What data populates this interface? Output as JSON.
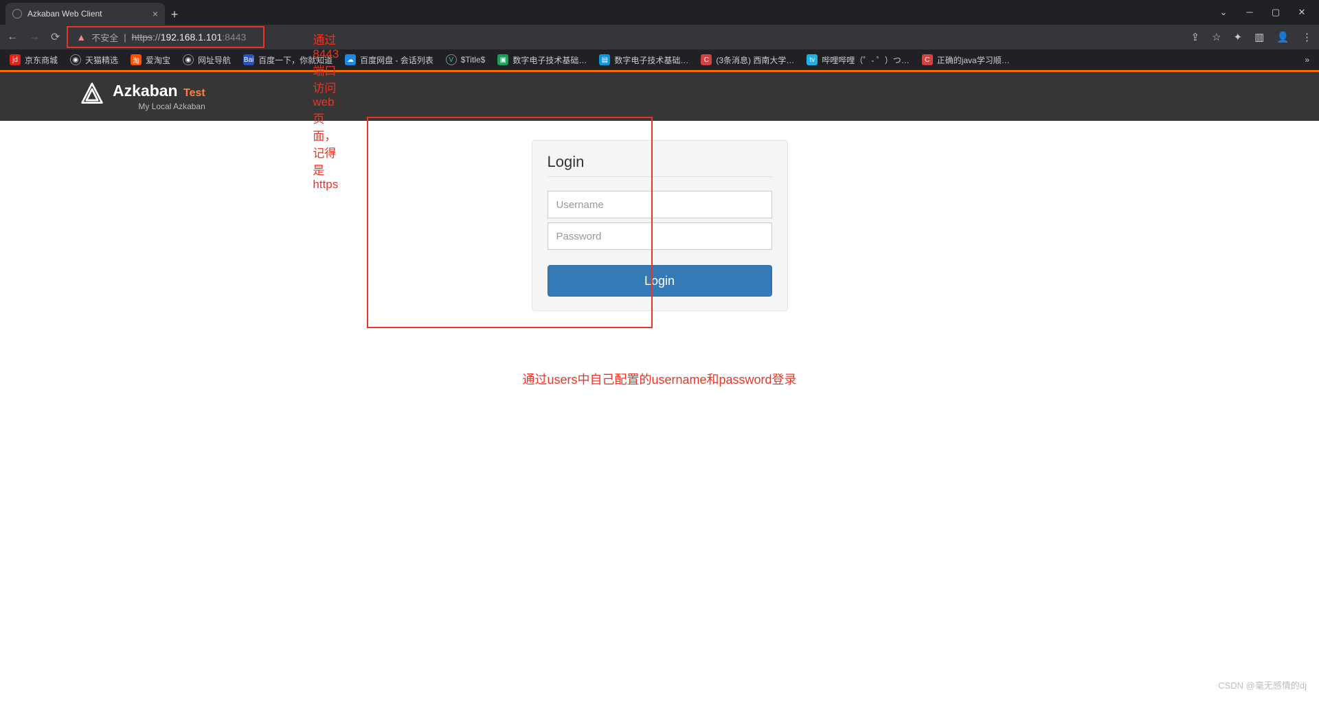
{
  "browser": {
    "tab_title": "Azkaban Web Client",
    "url_insecure_label": "不安全",
    "url_protocol": "https",
    "url_host": "192.168.1.101",
    "url_port": "8443"
  },
  "annotations": {
    "url_note": "通过8443端口访问web页面，记得是https",
    "login_note": "通过users中自己配置的username和password登录"
  },
  "bookmarks": [
    {
      "label": "京东商城",
      "bg": "#e2231a",
      "glyph": "jd"
    },
    {
      "label": "天猫精选",
      "bg": "transparent",
      "glyph": "◉"
    },
    {
      "label": "爱淘宝",
      "bg": "#ff5000",
      "glyph": "淘"
    },
    {
      "label": "网址导航",
      "bg": "transparent",
      "glyph": "◉"
    },
    {
      "label": "百度一下，你就知道",
      "bg": "#2a52be",
      "glyph": "Bai"
    },
    {
      "label": "百度网盘 - 会话列表",
      "bg": "#1e88e5",
      "glyph": "☁"
    },
    {
      "label": "$Title$",
      "bg": "transparent",
      "glyph": "V",
      "color": "#3c8"
    },
    {
      "label": "数字电子技术基础…",
      "bg": "#18a058",
      "glyph": "▣"
    },
    {
      "label": "数字电子技术基础…",
      "bg": "#1296db",
      "glyph": "▤"
    },
    {
      "label": "(3条消息) 西南大学…",
      "bg": "#d34242",
      "glyph": "C"
    },
    {
      "label": "哔哩哔哩（゜- ゜）つ…",
      "bg": "#23ade5",
      "glyph": "tv"
    },
    {
      "label": "正确的java学习顺…",
      "bg": "#d34242",
      "glyph": "C"
    }
  ],
  "azkaban": {
    "brand": "Azkaban",
    "brand_suffix": "Test",
    "subtitle": "My Local Azkaban",
    "login_title": "Login",
    "username_placeholder": "Username",
    "password_placeholder": "Password",
    "login_button": "Login"
  },
  "watermark": "CSDN @毫无感情的dj"
}
